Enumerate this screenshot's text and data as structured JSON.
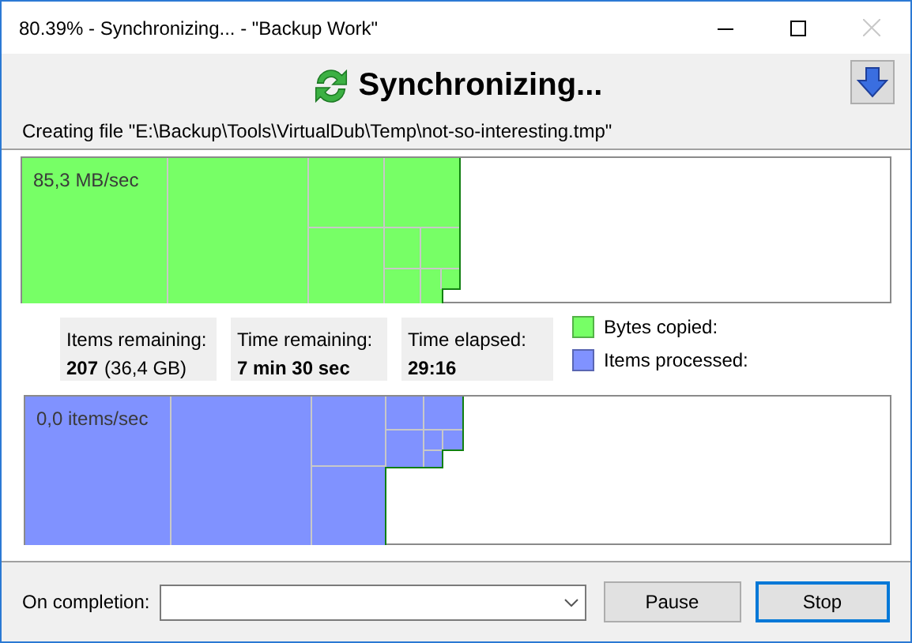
{
  "window": {
    "title": "80.39% - Synchronizing... - \"Backup Work\""
  },
  "header": {
    "title": "Synchronizing...",
    "status": "Creating file \"E:\\Backup\\Tools\\VirtualDub\\Temp\\not-so-interesting.tmp\""
  },
  "graphs": [
    {
      "label": "85,3 MB/sec",
      "color": "#77ff66"
    },
    {
      "label": "0,0 items/sec",
      "color": "#8092ff"
    }
  ],
  "stats": [
    {
      "label": "Items remaining:",
      "value": "207",
      "detail": "(36,4 GB)"
    },
    {
      "label": "Time remaining:",
      "value": "7 min 30 sec"
    },
    {
      "label": "Time elapsed:",
      "value": "29:16"
    }
  ],
  "legend": [
    {
      "label": "Bytes copied:",
      "color": "#77ff66"
    },
    {
      "label": "Items processed:",
      "color": "#8092ff"
    }
  ],
  "footer": {
    "label": "On completion:",
    "buttons": [
      {
        "label": "Pause",
        "default": false
      },
      {
        "label": "Stop",
        "default": true
      }
    ]
  }
}
